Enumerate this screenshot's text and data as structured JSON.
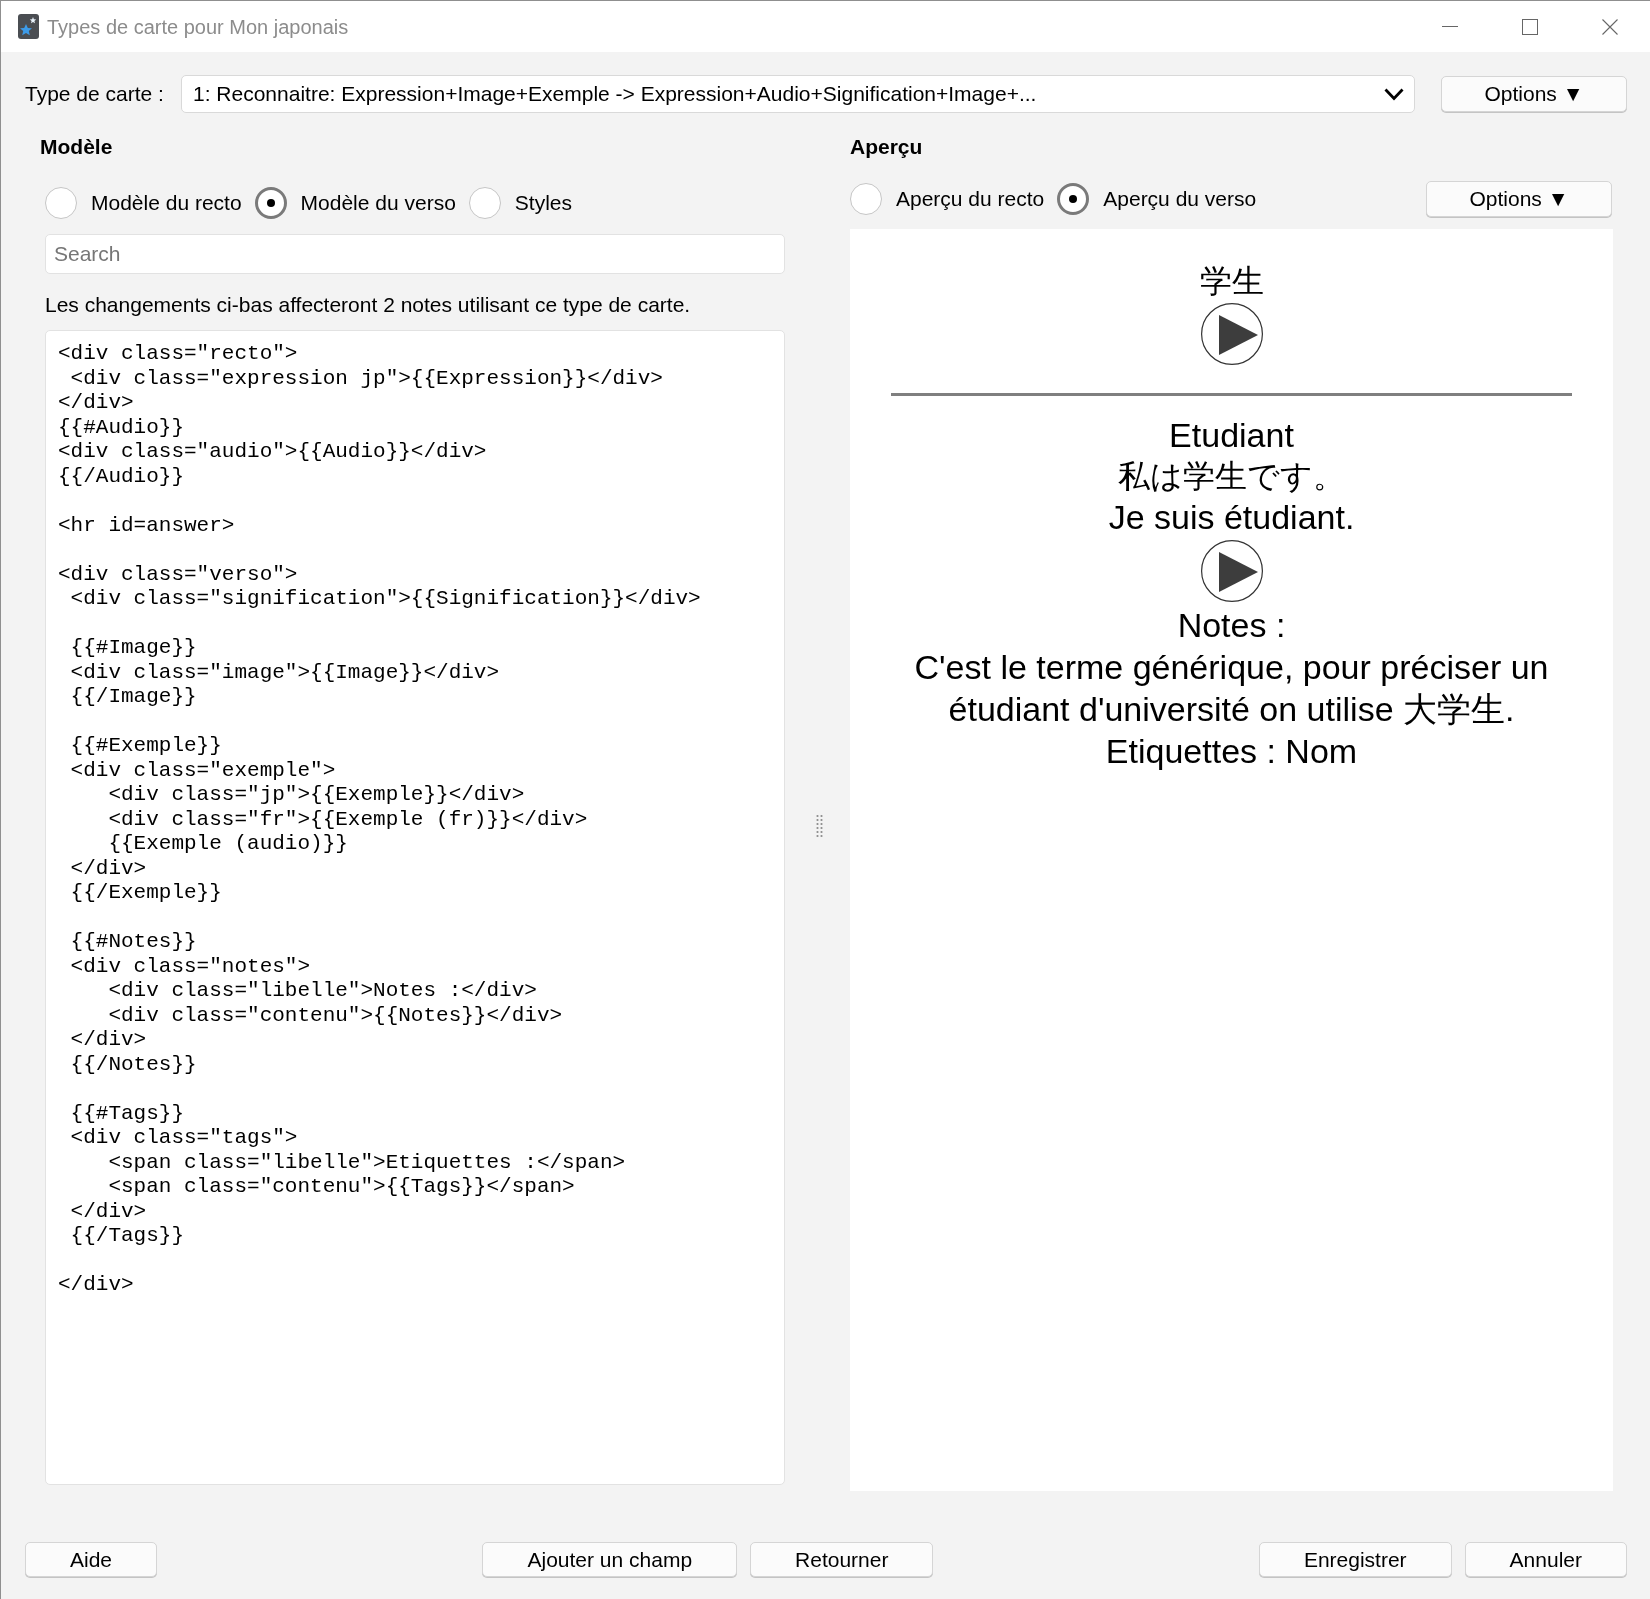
{
  "window": {
    "title": "Types de carte pour Mon japonais"
  },
  "card_type": {
    "label": "Type de carte :",
    "value": "1: Reconnaitre: Expression+Image+Exemple -> Expression+Audio+Signification+Image+...",
    "options_button": "Options ▼"
  },
  "template": {
    "heading": "Modèle",
    "views": [
      {
        "label": "Modèle du recto",
        "selected": false
      },
      {
        "label": "Modèle du verso",
        "selected": true
      },
      {
        "label": "Styles",
        "selected": false
      }
    ],
    "search": {
      "placeholder": "Search"
    },
    "notice": "Les changements ci-bas affecteront 2 notes utilisant ce type de carte.",
    "code": "<div class=\"recto\">\n <div class=\"expression jp\">{{Expression}}</div>\n</div>\n{{#Audio}}\n<div class=\"audio\">{{Audio}}</div>\n{{/Audio}}\n\n<hr id=answer>\n\n<div class=\"verso\">\n <div class=\"signification\">{{Signification}}</div>\n\n {{#Image}}\n <div class=\"image\">{{Image}}</div>\n {{/Image}}\n\n {{#Exemple}}\n <div class=\"exemple\">\n    <div class=\"jp\">{{Exemple}}</div>\n    <div class=\"fr\">{{Exemple (fr)}}</div>\n    {{Exemple (audio)}}\n </div>\n {{/Exemple}}\n\n {{#Notes}}\n <div class=\"notes\">\n    <div class=\"libelle\">Notes :</div>\n    <div class=\"contenu\">{{Notes}}</div>\n </div>\n {{/Notes}}\n\n {{#Tags}}\n <div class=\"tags\">\n    <span class=\"libelle\">Etiquettes :</span>\n    <span class=\"contenu\">{{Tags}}</span>\n </div>\n {{/Tags}}\n\n</div>"
  },
  "preview": {
    "heading": "Aperçu",
    "sides": [
      {
        "label": "Aperçu du recto",
        "selected": false
      },
      {
        "label": "Aperçu du verso",
        "selected": true
      }
    ],
    "options_button": "Options ▼",
    "card": [
      {
        "kind": "jp",
        "text": "学生"
      },
      {
        "kind": "audio"
      },
      {
        "kind": "answer_rule"
      },
      {
        "kind": "text",
        "text": "Etudiant"
      },
      {
        "kind": "jp",
        "text": "私は学生です。"
      },
      {
        "kind": "text",
        "text": "Je suis étudiant."
      },
      {
        "kind": "audio"
      },
      {
        "kind": "text",
        "text": "Notes :"
      },
      {
        "kind": "text",
        "text": "C'est le terme générique, pour préciser un étudiant d'université on utilise 大学生."
      },
      {
        "kind": "text",
        "text": "Etiquettes : Nom"
      }
    ]
  },
  "footer": {
    "left": [
      "Aide"
    ],
    "center": [
      "Ajouter un champ",
      "Retourner"
    ],
    "right": [
      "Enregistrer",
      "Annuler"
    ]
  }
}
